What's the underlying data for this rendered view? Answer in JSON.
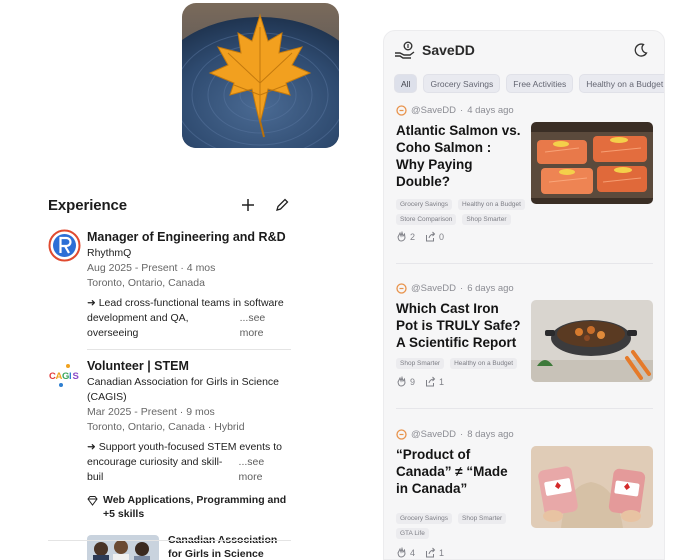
{
  "experience": {
    "title": "Experience",
    "jobs": [
      {
        "title": "Manager of Engineering and R&D",
        "company": "RhythmQ",
        "dates": "Aug 2025 - Present · 4 mos",
        "location": "Toronto, Ontario, Canada",
        "desc_line1": "➜ Lead cross-functional teams in software",
        "desc_line2": "development and QA, overseeing",
        "see_more": "...see more"
      },
      {
        "title": "Volunteer | STEM",
        "company": "Canadian Association for Girls in Science (CAGIS)",
        "dates": "Mar 2025 - Present · 9 mos",
        "location": "Toronto, Ontario, Canada · Hybrid",
        "desc_line1": "➜ Support youth-focused STEM events to",
        "desc_line2": "encourage curiosity and skill-buil",
        "see_more": "...see more",
        "skills": "Web Applications, Programming and +5 skills",
        "media_title": "Canadian Association for Girls in Science (CAGIS)",
        "logo_text": "CAGIS"
      }
    ]
  },
  "app": {
    "name": "SaveDD",
    "chips": [
      "All",
      "Grocery Savings",
      "Free Activities",
      "Healthy on a Budget",
      "N"
    ],
    "active_chip": "All",
    "posts": [
      {
        "author": "@SaveDD",
        "age": "4 days ago",
        "title": "Atlantic Salmon vs. Coho Salmon : Why Paying Double?",
        "tags": [
          "Grocery Savings",
          "Healthy on a Budget",
          "Store Comparison",
          "Shop Smarter"
        ],
        "likes": "2",
        "shares": "0"
      },
      {
        "author": "@SaveDD",
        "age": "6 days ago",
        "title": "Which Cast Iron Pot is TRULY Safe? A Scientific Report",
        "tags": [
          "Shop Smarter",
          "Healthy on a Budget"
        ],
        "likes": "9",
        "shares": "1"
      },
      {
        "author": "@SaveDD",
        "age": "8 days ago",
        "title": "“Product of Canada” ≠ “Made in Canada”",
        "tags": [
          "Grocery Savings",
          "Shop Smarter",
          "GTA Life"
        ],
        "likes": "4",
        "shares": "1"
      }
    ]
  },
  "colors": {
    "brand_orange": "#e8924a",
    "rhythmq_blue": "#2c6fd6",
    "leaf_amber": "#f2a01f",
    "stump_blue": "#2f4a6e"
  }
}
